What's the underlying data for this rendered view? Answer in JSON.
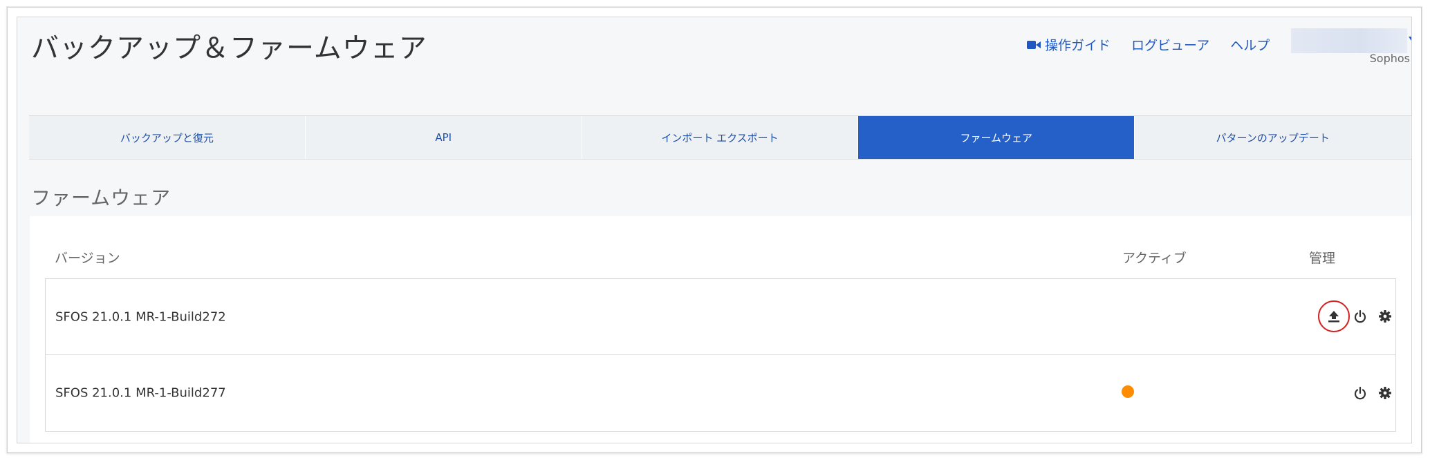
{
  "header": {
    "title": "バックアップ＆ファームウェア",
    "links": [
      {
        "label": "操作ガイド",
        "icon": "video-camera-icon"
      },
      {
        "label": "ログビューア"
      },
      {
        "label": "ヘルプ"
      }
    ],
    "org_label": "Sophos"
  },
  "tabs": [
    {
      "label": "バックアップと復元",
      "active": false
    },
    {
      "label": "API",
      "active": false
    },
    {
      "label": "インポート エクスポート",
      "active": false
    },
    {
      "label": "ファームウェア",
      "active": true
    },
    {
      "label": "パターンのアップデート",
      "active": false
    }
  ],
  "section": {
    "title": "ファームウェア",
    "columns": {
      "version": "バージョン",
      "active": "アクティブ",
      "manage": "管理"
    },
    "rows": [
      {
        "version": "SFOS 21.0.1 MR-1-Build272",
        "active": false,
        "actions": [
          "upload-icon",
          "power-icon",
          "gear-icon"
        ],
        "highlighted_action": "upload-icon"
      },
      {
        "version": "SFOS 21.0.1 MR-1-Build277",
        "active": true,
        "actions": [
          "power-icon",
          "gear-icon"
        ]
      }
    ]
  },
  "colors": {
    "accent": "#2460c8",
    "link": "#1f57c3",
    "active_indicator": "#ff8c00",
    "highlight": "#d22424"
  }
}
